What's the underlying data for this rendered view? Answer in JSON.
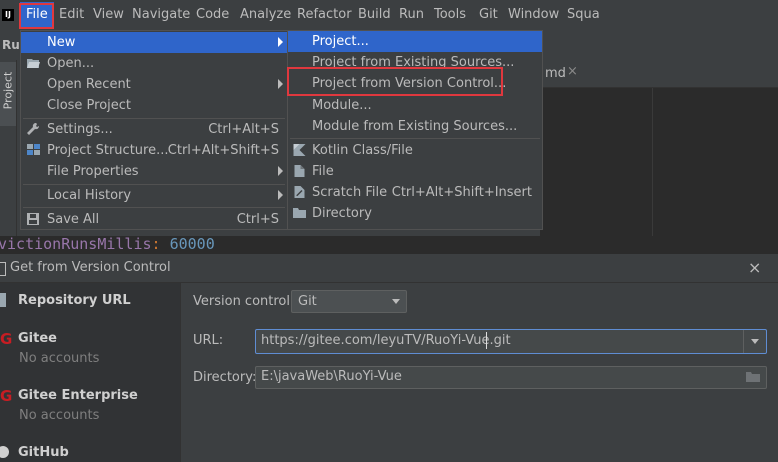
{
  "menubar": {
    "items": [
      "File",
      "Edit",
      "View",
      "Navigate",
      "Code",
      "Analyze",
      "Refactor",
      "Build",
      "Run",
      "Tools",
      "Git",
      "Window",
      "Squa"
    ]
  },
  "ide": {
    "toolwindow_label": "Ru",
    "side_tab_label": "Project",
    "editor_tab_label": "md",
    "editor_tab_close": "×",
    "code_line": {
      "identifier": "victionRunsMillis",
      "separator": ":",
      "value": "60000"
    }
  },
  "file_menu": {
    "items": [
      {
        "label": "New",
        "shortcut": "",
        "submenu": true,
        "selected": true,
        "icon": ""
      },
      {
        "label": "Open...",
        "shortcut": "",
        "submenu": false,
        "icon": "folder-open-icon"
      },
      {
        "label": "Open Recent",
        "shortcut": "",
        "submenu": true,
        "icon": ""
      },
      {
        "label": "Close Project",
        "shortcut": "",
        "submenu": false,
        "icon": ""
      },
      {
        "label": "Settings...",
        "shortcut": "Ctrl+Alt+S",
        "submenu": false,
        "icon": "wrench-icon"
      },
      {
        "label": "Project Structure...",
        "shortcut": "Ctrl+Alt+Shift+S",
        "submenu": false,
        "icon": "project-structure-icon"
      },
      {
        "label": "File Properties",
        "shortcut": "",
        "submenu": true,
        "icon": ""
      },
      {
        "label": "Local History",
        "shortcut": "",
        "submenu": true,
        "icon": ""
      },
      {
        "label": "Save All",
        "shortcut": "Ctrl+S",
        "submenu": false,
        "icon": "save-icon"
      }
    ]
  },
  "new_submenu": {
    "items": [
      {
        "label": "Project...",
        "shortcut": "",
        "selected": true,
        "icon": ""
      },
      {
        "label": "Project from Existing Sources...",
        "shortcut": "",
        "icon": ""
      },
      {
        "label": "Project from Version Control...",
        "shortcut": "",
        "icon": ""
      },
      {
        "label": "Module...",
        "shortcut": "",
        "icon": ""
      },
      {
        "label": "Module from Existing Sources...",
        "shortcut": "",
        "icon": ""
      },
      {
        "label": "Kotlin Class/File",
        "shortcut": "",
        "icon": "kotlin-icon"
      },
      {
        "label": "File",
        "shortcut": "",
        "icon": "file-icon"
      },
      {
        "label": "Scratch File",
        "shortcut": "Ctrl+Alt+Shift+Insert",
        "icon": "scratch-file-icon"
      },
      {
        "label": "Directory",
        "shortcut": "",
        "icon": "folder-icon"
      }
    ]
  },
  "dialog": {
    "title": "Get from Version Control",
    "close": "×",
    "sidebar": [
      {
        "title": "Repository URL",
        "subtitle": "",
        "icon": "repository-icon"
      },
      {
        "title": "Gitee",
        "subtitle": "No accounts",
        "icon": "gitee-icon"
      },
      {
        "title": "Gitee Enterprise",
        "subtitle": "No accounts",
        "icon": "gitee-icon"
      },
      {
        "title": "GitHub",
        "subtitle": "",
        "icon": "github-icon"
      }
    ],
    "form": {
      "vc_label": "Version control:",
      "vc_value": "Git",
      "url_label": "URL:",
      "url_value": "https://gitee.com/leyuTV/RuoYi-Vue.git",
      "dir_label": "Directory:",
      "dir_value": "E:\\javaWeb\\RuoYi-Vue"
    }
  },
  "colors": {
    "selection": "#2f65ca",
    "highlight_box": "#e0383e",
    "gitee": "#c71d23"
  }
}
